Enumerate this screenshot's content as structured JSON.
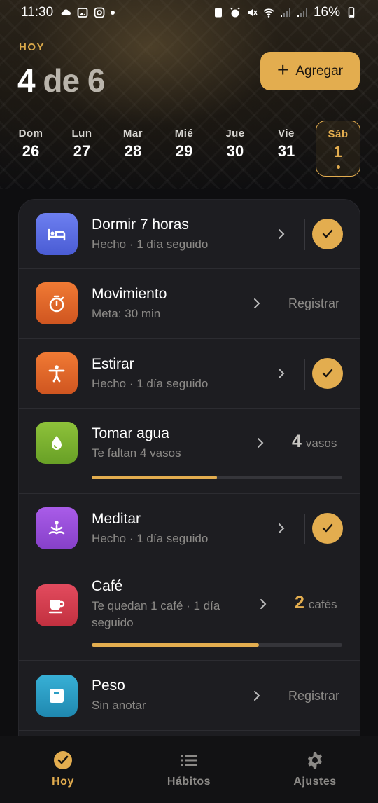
{
  "status_bar": {
    "time": "11:30",
    "battery": "16%"
  },
  "header": {
    "today_label": "HOY",
    "count_done": "4",
    "count_rest": " de 6",
    "add_label": "Agregar"
  },
  "week": [
    {
      "dow": "Dom",
      "num": "26"
    },
    {
      "dow": "Lun",
      "num": "27"
    },
    {
      "dow": "Mar",
      "num": "28"
    },
    {
      "dow": "Mié",
      "num": "29"
    },
    {
      "dow": "Jue",
      "num": "30"
    },
    {
      "dow": "Vie",
      "num": "31"
    },
    {
      "dow": "Sáb",
      "num": "1"
    }
  ],
  "habits": [
    {
      "name": "Dormir 7 horas",
      "sub": "Hecho · 1 día seguido",
      "icon": "bed-icon",
      "color": "#5b6fe0"
    },
    {
      "name": "Movimiento",
      "sub": "Meta: 30 min",
      "icon": "stopwatch-icon",
      "color": "#e0672a",
      "action": "Registrar"
    },
    {
      "name": "Estirar",
      "sub": "Hecho · 1 día seguido",
      "icon": "person-stretch-icon",
      "color": "#e0672a"
    },
    {
      "name": "Tomar agua",
      "sub": "Te faltan 4 vasos",
      "icon": "water-drop-icon",
      "color": "#7db32f",
      "count": "4",
      "unit": "vasos",
      "progress": 0.5
    },
    {
      "name": "Meditar",
      "sub": "Hecho · 1 día seguido",
      "icon": "meditation-icon",
      "color": "#9a4ed9"
    },
    {
      "name": "Café",
      "sub": "Te quedan 1 café · 1 día seguido",
      "icon": "coffee-cup-icon",
      "color": "#d83d50",
      "count": "2",
      "unit": "cafés",
      "progress": 0.667
    },
    {
      "name": "Peso",
      "sub": "Sin anotar",
      "icon": "scale-icon",
      "color": "#2b9dc4",
      "action": "Registrar"
    }
  ],
  "nav": [
    {
      "label": "Hoy",
      "icon": "check-circle-icon"
    },
    {
      "label": "Hábitos",
      "icon": "list-icon"
    },
    {
      "label": "Ajustes",
      "icon": "gear-icon"
    }
  ],
  "colors": {
    "accent": "#e3ad4f",
    "card": "#1d1d21",
    "background": "#0e0e10"
  }
}
